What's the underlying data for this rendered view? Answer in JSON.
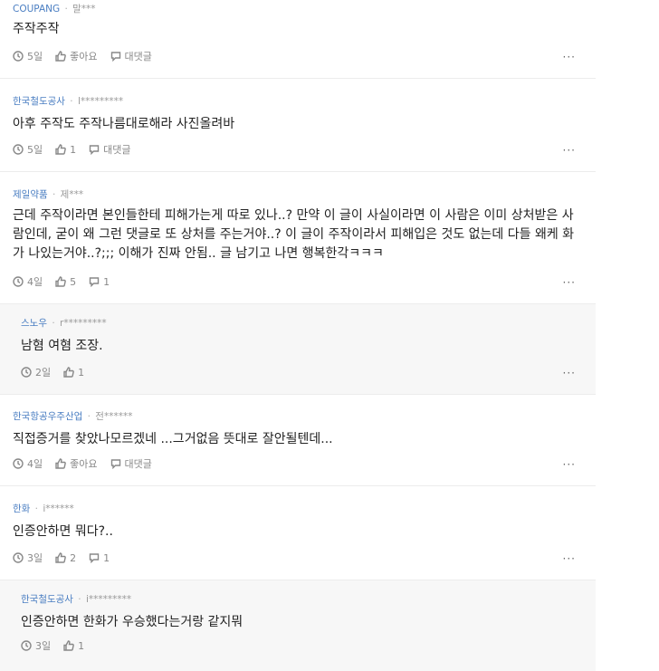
{
  "comments": [
    {
      "company": "COUPANG",
      "author": "말***",
      "text": "주작주작",
      "time": "5일",
      "like": "좋아요",
      "reply": "대댓글",
      "more": "···"
    },
    {
      "company": "한국철도공사",
      "author": "l*********",
      "text": "아후 주작도 주작나름대로해라 사진올려바",
      "time": "5일",
      "like": "1",
      "reply": "대댓글",
      "more": "···"
    },
    {
      "company": "제일약품",
      "author": "제***",
      "text": "근데 주작이라면 본인들한테 피해가는게 따로 있나..? 만약 이 글이 사실이라면 이 사람은 이미 상처받은 사람인데, 굳이 왜 그런 댓글로 또 상처를 주는거야..? 이 글이 주작이라서 피해입은 것도 없는데 다들 왜케 화가 나있는거야..?;;; 이해가 진짜 안됨.. 글 남기고 나면 행복한각ㅋㅋㅋ",
      "time": "4일",
      "like": "5",
      "reply": "1",
      "more": "···"
    },
    {
      "company": "스노우",
      "author": "r*********",
      "text": "남혐 여혐 조장.",
      "time": "2일",
      "like": "1",
      "more": "···"
    },
    {
      "company": "한국항공우주산업",
      "author": "전******",
      "text": "직접증거를 찾았나모르겠네 ...그거없음 뜻대로 잘안될텐데...",
      "time": "4일",
      "like": "좋아요",
      "reply": "대댓글",
      "more": "···"
    },
    {
      "company": "한화",
      "author": "i******",
      "text": "인증안하면 뭐다?..",
      "time": "3일",
      "like": "2",
      "reply": "1",
      "more": "···"
    },
    {
      "company": "한국철도공사",
      "author": "i*********",
      "text": "인증안하면 한화가 우승했다는거랑 같지뭐",
      "time": "3일",
      "like": "1"
    }
  ]
}
